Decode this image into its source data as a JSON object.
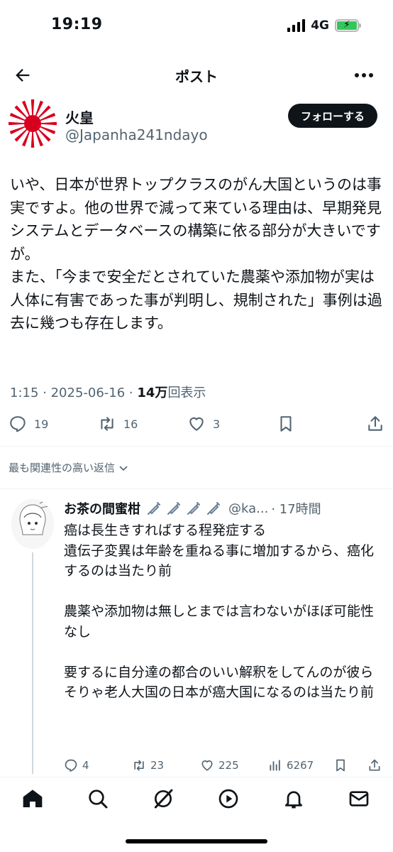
{
  "status_bar": {
    "time": "19:19",
    "network": "4G",
    "battery_icon": "battery-charging-icon"
  },
  "nav": {
    "title": "ポスト",
    "back_icon": "back-arrow-icon",
    "more_icon": "more-icon"
  },
  "author": {
    "name": "火皇",
    "handle": "@Japanha241ndayo",
    "follow_label": "フォローする"
  },
  "tweet": {
    "text": "いや、日本が世界トップクラスのがん大国というのは事実ですよ。他の世界で減って来ている理由は、早期発見システムとデータベースの構築に依る部分が大きいですが。\nまた、「今まで安全だとされていた農薬や添加物が実は人体に有害であった事が判明し、規制された」事例は過去に幾つも存在します。",
    "time": "1:15",
    "date": "2025-06-16",
    "views_count": "14万",
    "views_label": "回表示",
    "replies": "19",
    "retweets": "16",
    "likes": "3"
  },
  "sort_label": "最も関連性の高い返信",
  "reply": {
    "name": "お茶の間蜜柑",
    "handle": "@ka...",
    "time": "17時間",
    "text": "癌は長生きすればする程発症する\n遺伝子変異は年齢を重ねる事に増加するから、癌化するのは当たり前\n\n農薬や添加物は無しとまでは言わないがほぼ可能性なし\n\n要するに自分達の都合のいい解釈をしてんのが彼ら\nそりゃ老人大国の日本が癌大国になるのは当たり前",
    "replies": "4",
    "retweets": "23",
    "likes": "225",
    "views": "6267"
  },
  "colors": {
    "primary_text": "#0f1419",
    "secondary_text": "#536471",
    "flag_red": "#d7001f"
  }
}
